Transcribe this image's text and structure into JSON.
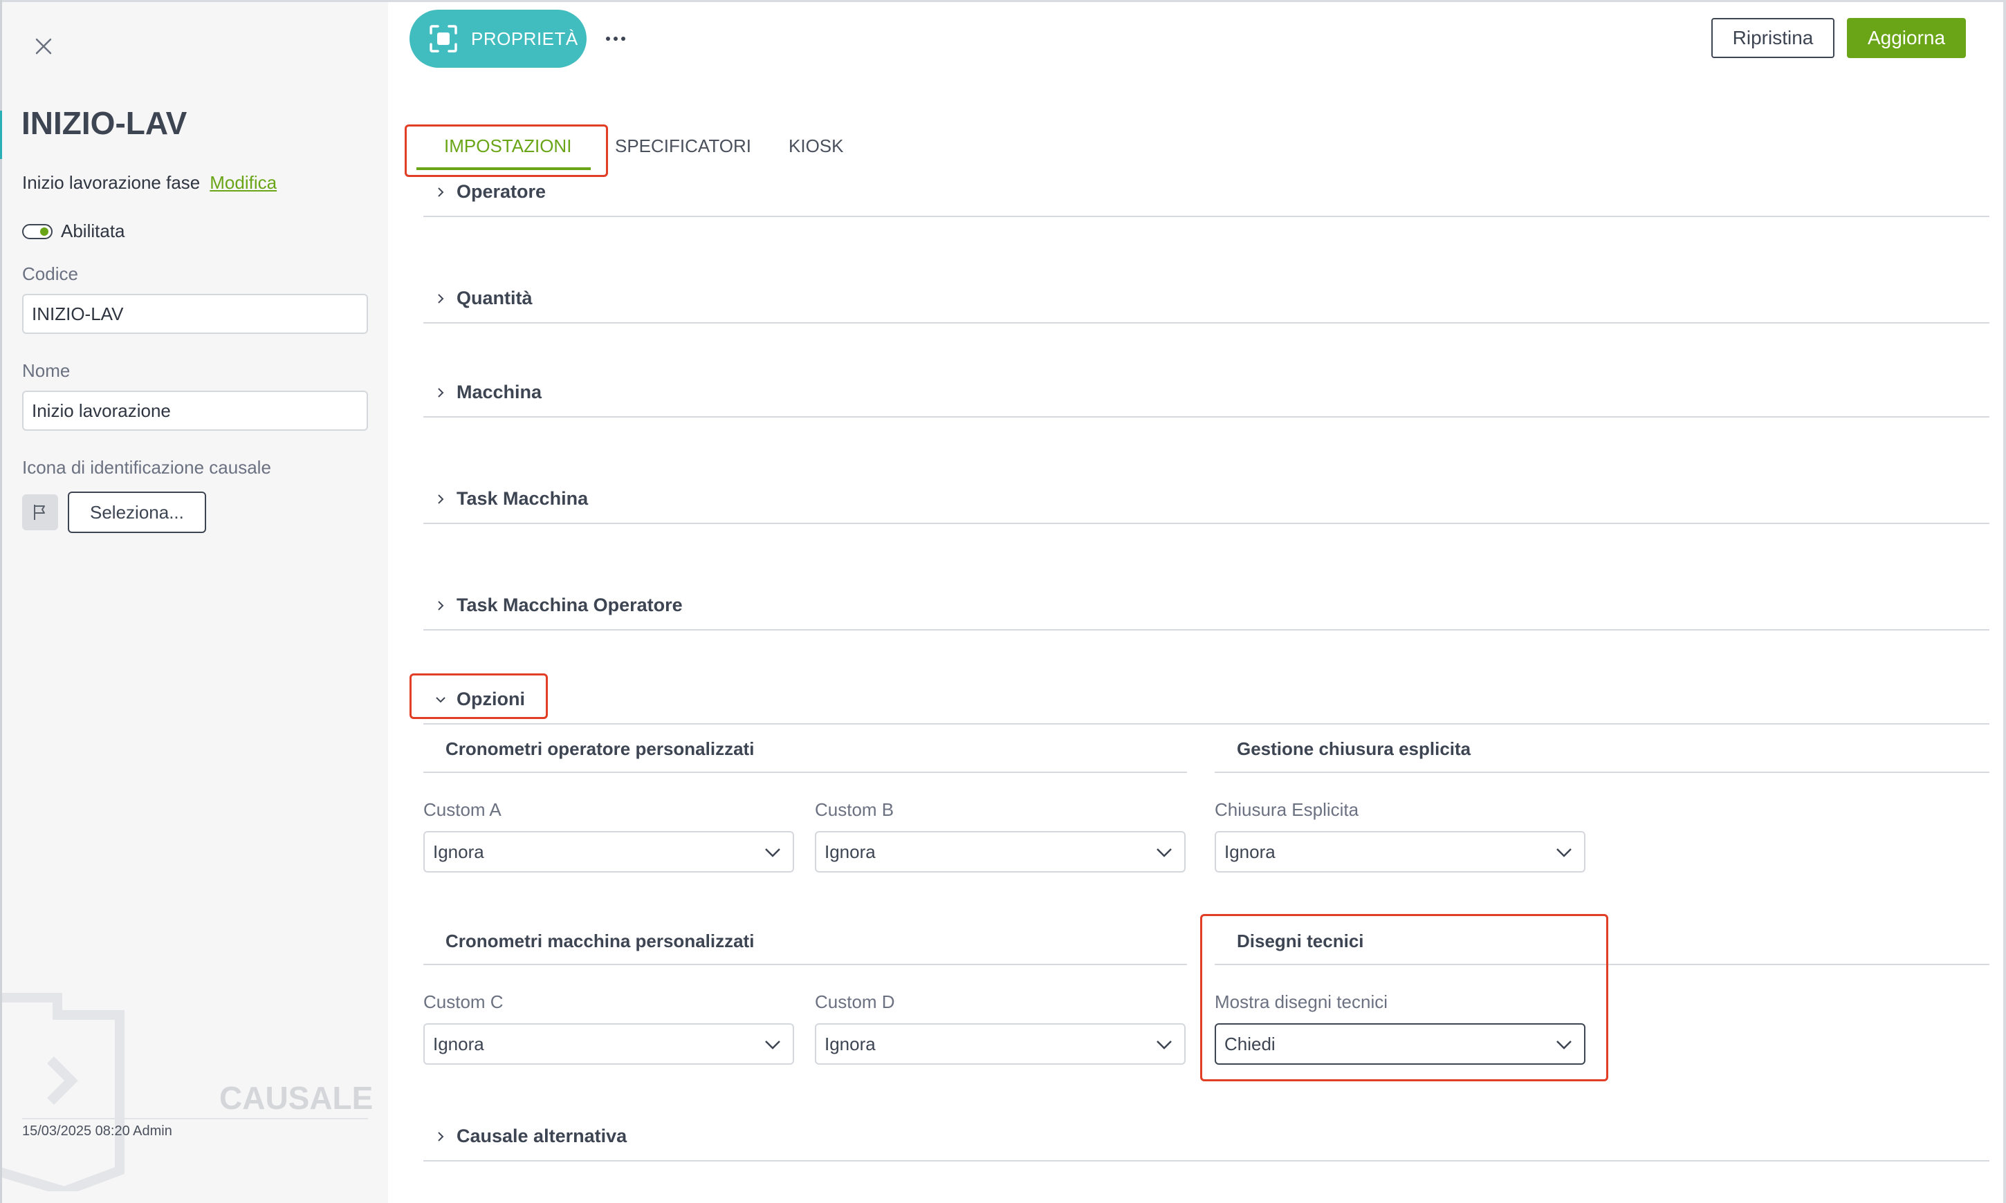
{
  "sidebar": {
    "code_title": "INIZIO-LAV",
    "description": "Inizio lavorazione fase",
    "edit_link": "Modifica",
    "enabled_label": "Abilitata",
    "code_label": "Codice",
    "code_value": "INIZIO-LAV",
    "name_label": "Nome",
    "name_value": "Inizio lavorazione",
    "icon_label": "Icona di identificazione causale",
    "select_button": "Seleziona...",
    "watermark": "CAUSALE",
    "footer": "15/03/2025 08:20 Admin"
  },
  "toolbar": {
    "properties": "PROPRIETÀ",
    "reset": "Ripristina",
    "update": "Aggiorna"
  },
  "tabs": [
    {
      "label": "IMPOSTAZIONI",
      "active": true
    },
    {
      "label": "SPECIFICATORI"
    },
    {
      "label": "KIOSK"
    }
  ],
  "sections": [
    {
      "title": "Operatore"
    },
    {
      "title": "Quantità"
    },
    {
      "title": "Macchina"
    },
    {
      "title": "Task Macchina"
    },
    {
      "title": "Task Macchina Operatore"
    },
    {
      "title": "Opzioni",
      "expanded": true
    },
    {
      "title": "Causale alternativa"
    }
  ],
  "options": {
    "operator_timers": {
      "title": "Cronometri operatore personalizzati",
      "fields": [
        {
          "label": "Custom A",
          "value": "Ignora"
        },
        {
          "label": "Custom B",
          "value": "Ignora"
        }
      ]
    },
    "explicit_close": {
      "title": "Gestione chiusura esplicita",
      "fields": [
        {
          "label": "Chiusura Esplicita",
          "value": "Ignora"
        }
      ]
    },
    "machine_timers": {
      "title": "Cronometri macchina personalizzati",
      "fields": [
        {
          "label": "Custom C",
          "value": "Ignora"
        },
        {
          "label": "Custom D",
          "value": "Ignora"
        }
      ]
    },
    "technical_drawings": {
      "title": "Disegni tecnici",
      "fields": [
        {
          "label": "Mostra disegni tecnici",
          "value": "Chiedi"
        }
      ]
    }
  },
  "colors": {
    "accent_green": "#6aa517",
    "teal": "#41bcbf",
    "highlight_red": "#e23d25"
  }
}
